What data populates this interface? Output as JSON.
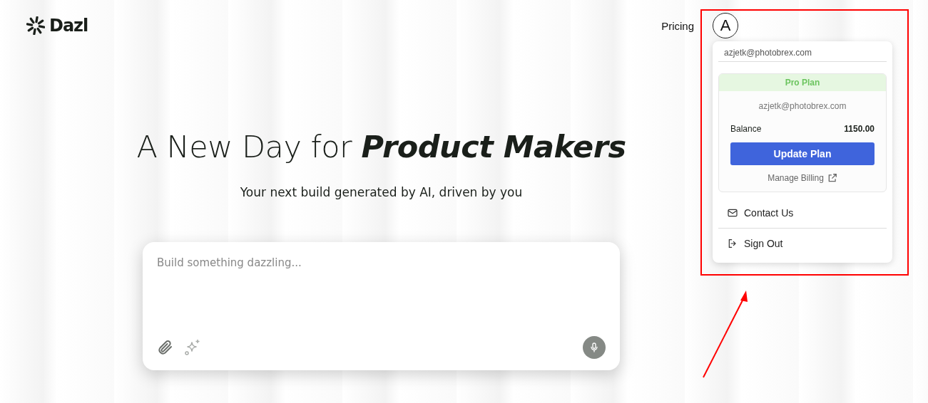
{
  "header": {
    "logo": "Dazl",
    "nav": [
      "Pricing"
    ],
    "avatar": "A"
  },
  "account_menu": {
    "email": "azjetk@photobrex.com",
    "plan": {
      "name": "Pro Plan",
      "email": "azjetk@photobrex.com",
      "balance_label": "Balance",
      "balance": "1150.00",
      "button": "Update Plan",
      "billing_link": "Manage Billing"
    },
    "items": [
      {
        "kind": "contact",
        "label": "Contact Us"
      },
      {
        "kind": "signout",
        "label": "Sign Out"
      }
    ]
  },
  "hero": {
    "title": "A New Day for",
    "title_emphasis": "Product Makers",
    "subtitle": "Your next build generated by AI, driven by you"
  },
  "prompt": {
    "placeholder": "Build something dazzling..."
  }
}
